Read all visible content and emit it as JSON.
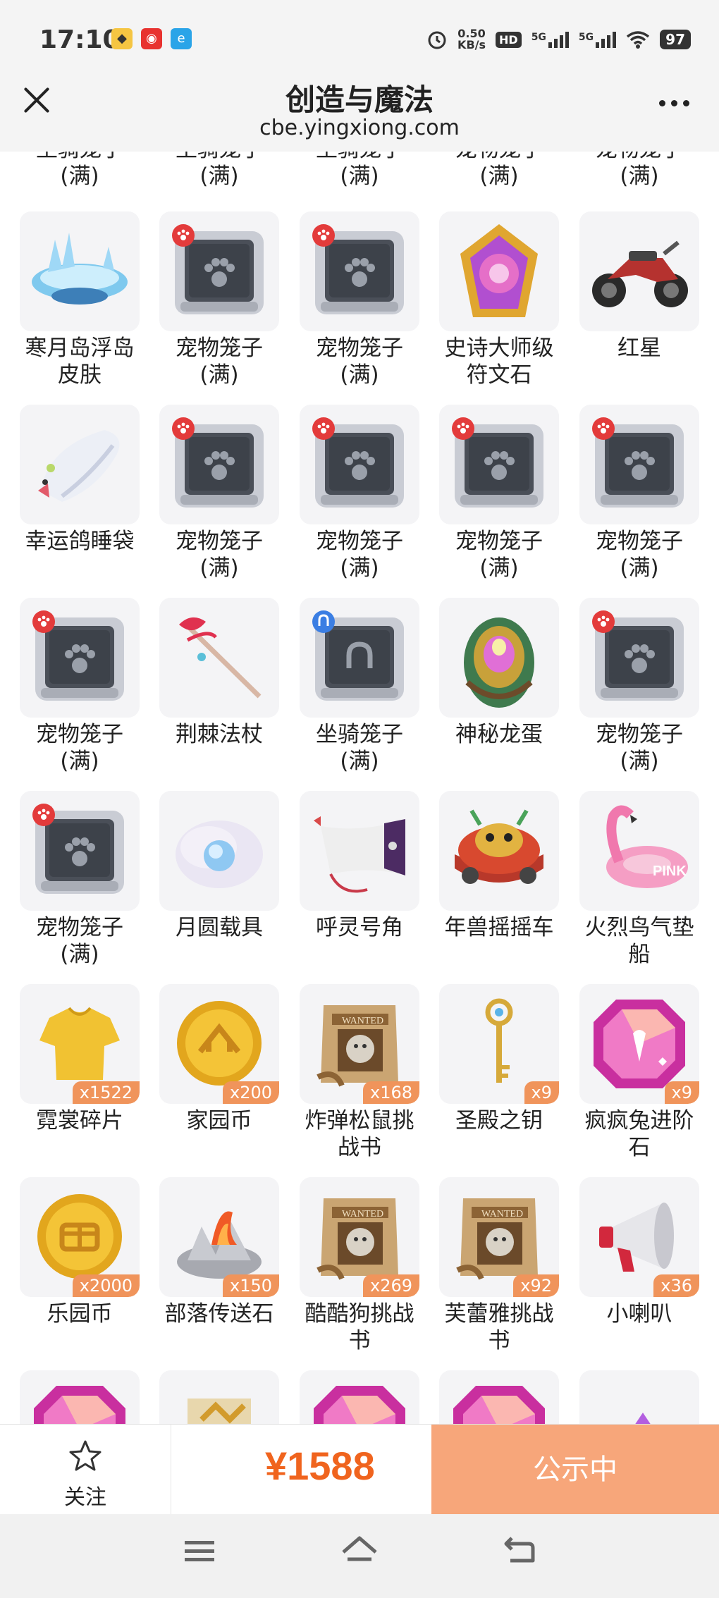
{
  "status_bar": {
    "time": "17:10",
    "speed_value": "0.50",
    "speed_unit": "KB/s",
    "hd_label": "HD",
    "sim1_label": "5G",
    "sim2_label": "5G",
    "battery": "97"
  },
  "header": {
    "title": "创造与魔法",
    "url": "cbe.yingxiong.com"
  },
  "top_partial_labels": [
    [
      "坐骑笼子",
      "(满)"
    ],
    [
      "坐骑笼子",
      "(满)"
    ],
    [
      "坐骑笼子",
      "(满)"
    ],
    [
      "宠物笼子",
      "(满)"
    ],
    [
      "宠物笼子",
      "(满)"
    ]
  ],
  "items": [
    {
      "l1": "寒月岛浮岛",
      "l2": "皮肤",
      "icon": "floating-island-skin-icon",
      "count": ""
    },
    {
      "l1": "宠物笼子",
      "l2": "(满)",
      "icon": "pet-cage-icon",
      "count": ""
    },
    {
      "l1": "宠物笼子",
      "l2": "(满)",
      "icon": "pet-cage-icon",
      "count": ""
    },
    {
      "l1": "史诗大师级",
      "l2": "符文石",
      "icon": "rune-stone-icon",
      "count": ""
    },
    {
      "l1": "红星",
      "l2": "",
      "icon": "motorcycle-icon",
      "count": ""
    },
    {
      "l1": "幸运鸽睡袋",
      "l2": "",
      "icon": "pigeon-sleeping-bag-icon",
      "count": ""
    },
    {
      "l1": "宠物笼子",
      "l2": "(满)",
      "icon": "pet-cage-icon",
      "count": ""
    },
    {
      "l1": "宠物笼子",
      "l2": "(满)",
      "icon": "pet-cage-icon",
      "count": ""
    },
    {
      "l1": "宠物笼子",
      "l2": "(满)",
      "icon": "pet-cage-icon",
      "count": ""
    },
    {
      "l1": "宠物笼子",
      "l2": "(满)",
      "icon": "pet-cage-icon",
      "count": ""
    },
    {
      "l1": "宠物笼子",
      "l2": "(满)",
      "icon": "pet-cage-icon",
      "count": ""
    },
    {
      "l1": "荆棘法杖",
      "l2": "",
      "icon": "thorn-staff-icon",
      "count": ""
    },
    {
      "l1": "坐骑笼子",
      "l2": "(满)",
      "icon": "mount-cage-icon",
      "count": ""
    },
    {
      "l1": "神秘龙蛋",
      "l2": "",
      "icon": "dragon-egg-icon",
      "count": ""
    },
    {
      "l1": "宠物笼子",
      "l2": "(满)",
      "icon": "pet-cage-icon",
      "count": ""
    },
    {
      "l1": "宠物笼子",
      "l2": "(满)",
      "icon": "pet-cage-icon",
      "count": ""
    },
    {
      "l1": "月圆载具",
      "l2": "",
      "icon": "moon-vehicle-icon",
      "count": ""
    },
    {
      "l1": "呼灵号角",
      "l2": "",
      "icon": "horn-icon",
      "count": ""
    },
    {
      "l1": "年兽摇摇车",
      "l2": "",
      "icon": "nian-rocking-car-icon",
      "count": ""
    },
    {
      "l1": "火烈鸟气垫",
      "l2": "船",
      "icon": "flamingo-float-icon",
      "count": ""
    },
    {
      "l1": "霓裳碎片",
      "l2": "",
      "icon": "shirt-fragment-icon",
      "count": "x1522"
    },
    {
      "l1": "家园币",
      "l2": "",
      "icon": "home-coin-icon",
      "count": "x200"
    },
    {
      "l1": "炸弹松鼠挑",
      "l2": "战书",
      "icon": "wanted-poster-icon",
      "count": "x168"
    },
    {
      "l1": "圣殿之钥",
      "l2": "",
      "icon": "temple-key-icon",
      "count": "x9"
    },
    {
      "l1": "疯疯兔进阶",
      "l2": "石",
      "icon": "rabbit-stone-icon",
      "count": "x9"
    },
    {
      "l1": "乐园币",
      "l2": "",
      "icon": "park-coin-icon",
      "count": "x2000"
    },
    {
      "l1": "部落传送石",
      "l2": "",
      "icon": "tribe-teleport-stone-icon",
      "count": "x150"
    },
    {
      "l1": "酷酷狗挑战",
      "l2": "书",
      "icon": "wanted-poster-icon",
      "count": "x269"
    },
    {
      "l1": "芙蕾雅挑战",
      "l2": "书",
      "icon": "wanted-poster-icon",
      "count": "x92"
    },
    {
      "l1": "小喇叭",
      "l2": "",
      "icon": "megaphone-icon",
      "count": "x36"
    }
  ],
  "bottom_partial_icons": [
    "gem-stone-icon",
    "scroll-icon",
    "gem-stone-icon",
    "gem-stone-icon",
    "purple-item-icon"
  ],
  "action_bar": {
    "follow_label": "关注",
    "price": "¥1588",
    "public_label": "公示中"
  },
  "colors": {
    "price": "#f0641e",
    "public_button": "#f7a67a",
    "count_badge": "#f0945b"
  }
}
